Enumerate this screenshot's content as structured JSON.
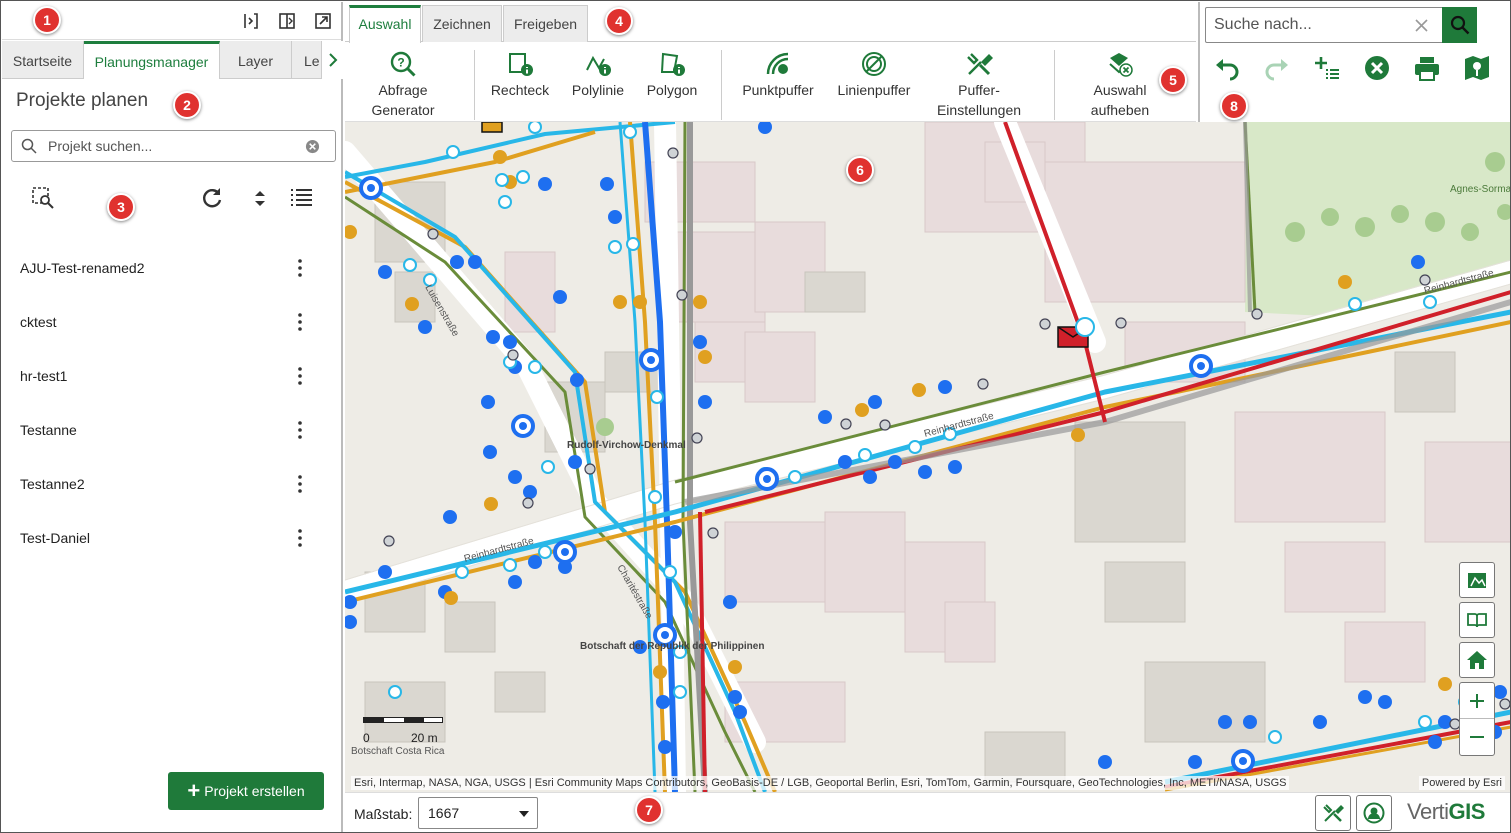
{
  "left_panel": {
    "tabs": [
      "Startseite",
      "Planungsmanager",
      "Layer",
      "Le"
    ],
    "title": "Projekte planen",
    "search_placeholder": "Projekt suchen...",
    "projects": [
      "AJU-Test-renamed2",
      "cktest",
      "hr-test1",
      "Testanne",
      "Testanne2",
      "Test-Daniel"
    ],
    "create_button": "Projekt erstellen"
  },
  "ribbon": {
    "tabs": [
      "Auswahl",
      "Zeichnen",
      "Freigeben"
    ],
    "buttons": [
      {
        "label": "Abfrage Generator",
        "icon": "query-generator-icon"
      },
      {
        "label": "Rechteck",
        "icon": "rectangle-select-icon"
      },
      {
        "label": "Polylinie",
        "icon": "polyline-select-icon"
      },
      {
        "label": "Polygon",
        "icon": "polygon-select-icon"
      },
      {
        "label": "Punktpuffer",
        "icon": "point-buffer-icon"
      },
      {
        "label": "Linienpuffer",
        "icon": "line-buffer-icon"
      },
      {
        "label": "Puffer-Einstellungen",
        "icon": "buffer-settings-icon"
      },
      {
        "label": "Auswahl aufheben",
        "icon": "clear-selection-icon"
      }
    ]
  },
  "global_search": {
    "placeholder": "Suche nach..."
  },
  "map": {
    "labels": [
      "Reinhardtstraße",
      "Reinhardtstraße",
      "Reinhardtstraße",
      "Luisenstraße",
      "Charitéstraße",
      "Rudolf-Virchow-Denkmal",
      "Botschaft der Republik der Philippinen",
      "Agnes-Sorma-Park",
      "Botschaft Costa Rica"
    ],
    "attribution": "Esri, Intermap, NASA, NGA, USGS | Esri Community Maps Contributors, GeoBasis-DE / LGB, Geoportal Berlin, Esri, TomTom, Garmin, Foursquare, GeoTechnologies, Inc, METI/NASA, USGS",
    "powered_by": "Powered by Esri",
    "scale_labels": [
      "0",
      "20 m"
    ]
  },
  "bottom_bar": {
    "scale_label": "Maßstab:",
    "scale_value": "1667",
    "logo_a": "Verti",
    "logo_b": "GIS"
  },
  "badges": [
    "1",
    "2",
    "3",
    "4",
    "5",
    "6",
    "7",
    "8"
  ],
  "colors": {
    "accent": "#1f7a3a",
    "badge": "#e0322f",
    "network_blue": "#1e6ff0",
    "network_orange": "#e0a020",
    "network_red": "#d0202a",
    "network_cyan": "#28b7e8"
  }
}
